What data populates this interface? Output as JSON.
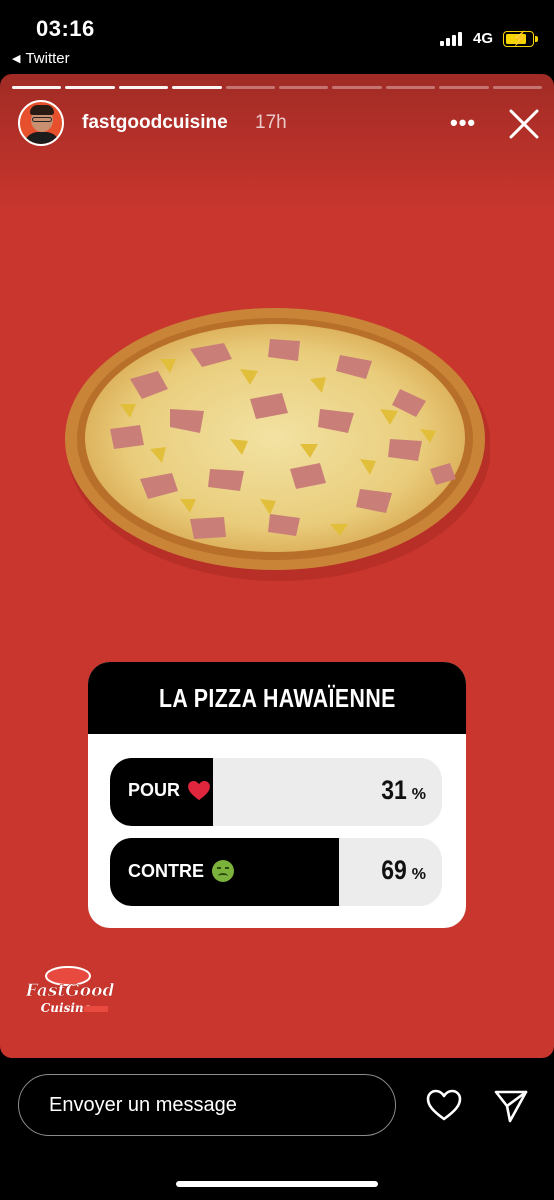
{
  "status_bar": {
    "time": "03:16",
    "back_app": "Twitter",
    "network": "4G",
    "battery_state": "charging",
    "accent_color": "#f5d400"
  },
  "story": {
    "background_color": "#c9362e",
    "progress_segments": {
      "total": 10,
      "completed": 4
    },
    "username": "fastgoodcuisine",
    "time_ago": "17h",
    "more_icon": "more-horizontal-icon",
    "close_icon": "close-icon",
    "image": "hawaiian-pizza",
    "poll": {
      "title": "LA PIZZA HAWAÏENNE",
      "options": [
        {
          "label": "POUR",
          "emoji": "red-heart-icon",
          "percent": 31,
          "percent_sign": "%"
        },
        {
          "label": "CONTRE",
          "emoji": "nauseated-face-icon",
          "percent": 69,
          "percent_sign": "%"
        }
      ]
    },
    "logo": "Fast Good Cuisine"
  },
  "bottom_bar": {
    "message_placeholder": "Envoyer un message",
    "like_icon": "heart-outline-icon",
    "send_icon": "send-icon"
  }
}
